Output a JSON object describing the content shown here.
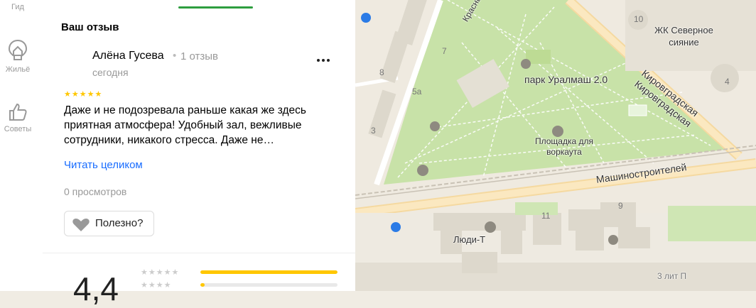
{
  "rail": {
    "items": [
      {
        "label": "Гид",
        "icon": "guide-icon"
      },
      {
        "label": "Жильё",
        "icon": "housing-icon"
      },
      {
        "label": "Советы",
        "icon": "thumb-up-icon"
      }
    ]
  },
  "review": {
    "section_title": "Ваш отзыв",
    "author": "Алёна Гусева",
    "author_reviews": "1 отзыв",
    "date": "сегодня",
    "stars": "★★★★★",
    "text": "Даже и не подозревала раньше какая же здесь приятная атмосфера! Удобный зал, вежливые сотрудники, никакого стресса. Даже не…",
    "read_more": "Читать целиком",
    "views": "0 просмотров",
    "useful_label": "Полезно?"
  },
  "rating": {
    "value": "4,4",
    "rows": [
      {
        "stars": "★★★★★",
        "fraction": 1.0
      },
      {
        "stars": "★★★★",
        "fraction": 0.03
      }
    ],
    "accent": "#ffc700"
  },
  "map": {
    "labels": {
      "park": "парк Уралмаш 2.0",
      "workout": "Площадка для воркаута",
      "street_krasnykh": "Красных Б",
      "street_kirov1": "Кировградская",
      "street_kirov2": "Кировградская",
      "street_mash": "Машиностроителей",
      "zhk": "ЖК Северное сияние",
      "lyudi": "Люди-Т",
      "lit": "3 лит П"
    },
    "numbers": [
      "10",
      "7",
      "8",
      "5а",
      "3",
      "4",
      "11",
      "9"
    ]
  }
}
